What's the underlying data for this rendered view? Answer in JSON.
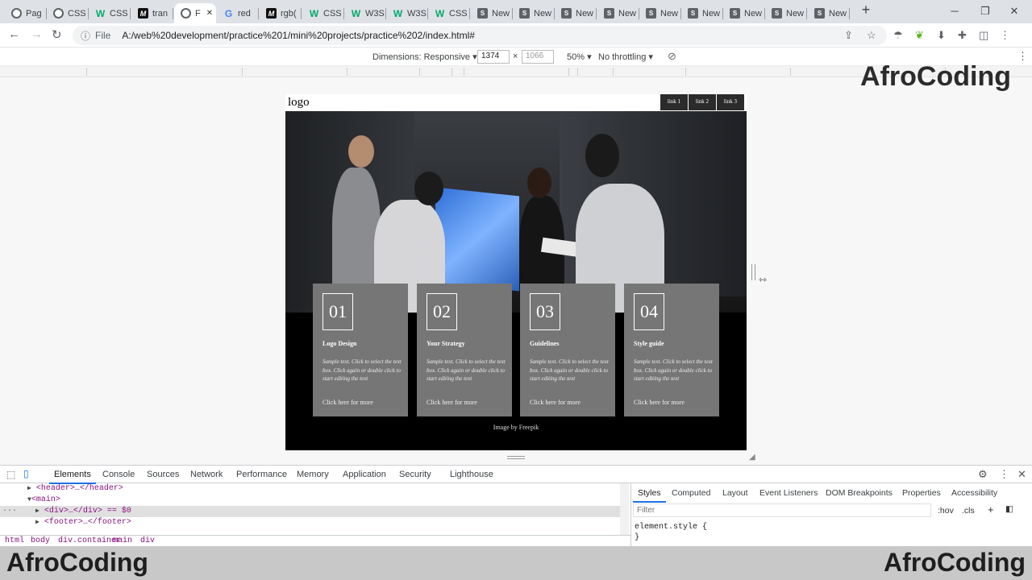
{
  "browser": {
    "tabs": [
      {
        "icon": "globe-icon",
        "label": "Pag"
      },
      {
        "icon": "globe-icon",
        "label": "CSS"
      },
      {
        "icon": "w3schools-icon",
        "label": "CSS"
      },
      {
        "icon": "m-icon",
        "label": "tran"
      },
      {
        "icon": "globe-icon",
        "label": "F",
        "active": true
      },
      {
        "icon": "google-icon",
        "label": "red"
      },
      {
        "icon": "m-icon",
        "label": "rgb("
      },
      {
        "icon": "w3schools-icon",
        "label": "CSS"
      },
      {
        "icon": "w3schools-icon",
        "label": "W3S"
      },
      {
        "icon": "w3schools-icon",
        "label": "W3S"
      },
      {
        "icon": "w3schools-icon",
        "label": "CSS"
      },
      {
        "icon": "s-icon",
        "label": "New"
      },
      {
        "icon": "s-icon",
        "label": "New"
      },
      {
        "icon": "s-icon",
        "label": "New"
      },
      {
        "icon": "s-icon",
        "label": "New"
      },
      {
        "icon": "s-icon",
        "label": "New"
      },
      {
        "icon": "s-icon",
        "label": "New"
      },
      {
        "icon": "s-icon",
        "label": "New"
      },
      {
        "icon": "s-icon",
        "label": "New"
      },
      {
        "icon": "s-icon",
        "label": "New"
      }
    ],
    "omnibox": {
      "scheme_label": "File",
      "url": "A:/web%20development/practice%201/mini%20projects/practice%202/index.html#"
    }
  },
  "device_toolbar": {
    "dimensions_label": "Dimensions: Responsive",
    "width": "1374",
    "times": "×",
    "height": "1066",
    "zoom": "50%",
    "throttling": "No throttling"
  },
  "watermark": "AfroCoding",
  "site": {
    "logo": "logo",
    "nav_links": [
      "link 1",
      "link 2",
      "link 3"
    ],
    "cards": [
      {
        "number": "01",
        "title": "Logo Design",
        "text": "Sample text. Click to select the text box. Click again or double click to start editing the text",
        "link": "Click here for more"
      },
      {
        "number": "02",
        "title": "Your Strategy",
        "text": "Sample text. Click to select the text box. Click again or double click to start editing the text",
        "link": "Click here for more"
      },
      {
        "number": "03",
        "title": "Guidelines",
        "text": "Sample text. Click to select the text box. Click again or double click to start editing the text",
        "link": "Click here for more"
      },
      {
        "number": "04",
        "title": "Style guide",
        "text": "Sample text. Click to select the text box. Click again or double click to start editing the text",
        "link": "Click here for more"
      }
    ],
    "credit": "Image by Freepik"
  },
  "devtools": {
    "tabs": [
      "Elements",
      "Console",
      "Sources",
      "Network",
      "Performance",
      "Memory",
      "Application",
      "Security",
      "Lighthouse"
    ],
    "active_tab": "Elements",
    "dom_lines": [
      "<header>…</header>",
      "<main>",
      "<div>…</div> == $0",
      "<footer>…</footer>"
    ],
    "breadcrumbs": [
      "html",
      "body",
      "div.container",
      "main",
      "div"
    ],
    "styles_tabs": [
      "Styles",
      "Computed",
      "Layout",
      "Event Listeners",
      "DOM Breakpoints",
      "Properties",
      "Accessibility"
    ],
    "filter_placeholder": "Filter",
    "hov_label": ":hov",
    "cls_label": ".cls",
    "element_style": "element.style {",
    "close_brace": "}"
  }
}
